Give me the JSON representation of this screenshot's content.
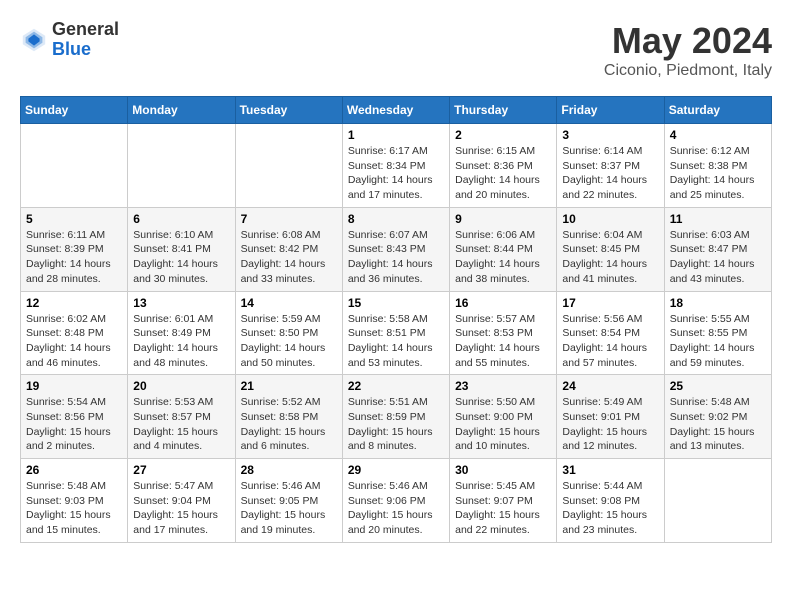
{
  "logo": {
    "general": "General",
    "blue": "Blue"
  },
  "title": {
    "month_year": "May 2024",
    "location": "Ciconio, Piedmont, Italy"
  },
  "weekdays": [
    "Sunday",
    "Monday",
    "Tuesday",
    "Wednesday",
    "Thursday",
    "Friday",
    "Saturday"
  ],
  "weeks": [
    [
      {
        "day": "",
        "info": ""
      },
      {
        "day": "",
        "info": ""
      },
      {
        "day": "",
        "info": ""
      },
      {
        "day": "1",
        "info": "Sunrise: 6:17 AM\nSunset: 8:34 PM\nDaylight: 14 hours\nand 17 minutes."
      },
      {
        "day": "2",
        "info": "Sunrise: 6:15 AM\nSunset: 8:36 PM\nDaylight: 14 hours\nand 20 minutes."
      },
      {
        "day": "3",
        "info": "Sunrise: 6:14 AM\nSunset: 8:37 PM\nDaylight: 14 hours\nand 22 minutes."
      },
      {
        "day": "4",
        "info": "Sunrise: 6:12 AM\nSunset: 8:38 PM\nDaylight: 14 hours\nand 25 minutes."
      }
    ],
    [
      {
        "day": "5",
        "info": "Sunrise: 6:11 AM\nSunset: 8:39 PM\nDaylight: 14 hours\nand 28 minutes."
      },
      {
        "day": "6",
        "info": "Sunrise: 6:10 AM\nSunset: 8:41 PM\nDaylight: 14 hours\nand 30 minutes."
      },
      {
        "day": "7",
        "info": "Sunrise: 6:08 AM\nSunset: 8:42 PM\nDaylight: 14 hours\nand 33 minutes."
      },
      {
        "day": "8",
        "info": "Sunrise: 6:07 AM\nSunset: 8:43 PM\nDaylight: 14 hours\nand 36 minutes."
      },
      {
        "day": "9",
        "info": "Sunrise: 6:06 AM\nSunset: 8:44 PM\nDaylight: 14 hours\nand 38 minutes."
      },
      {
        "day": "10",
        "info": "Sunrise: 6:04 AM\nSunset: 8:45 PM\nDaylight: 14 hours\nand 41 minutes."
      },
      {
        "day": "11",
        "info": "Sunrise: 6:03 AM\nSunset: 8:47 PM\nDaylight: 14 hours\nand 43 minutes."
      }
    ],
    [
      {
        "day": "12",
        "info": "Sunrise: 6:02 AM\nSunset: 8:48 PM\nDaylight: 14 hours\nand 46 minutes."
      },
      {
        "day": "13",
        "info": "Sunrise: 6:01 AM\nSunset: 8:49 PM\nDaylight: 14 hours\nand 48 minutes."
      },
      {
        "day": "14",
        "info": "Sunrise: 5:59 AM\nSunset: 8:50 PM\nDaylight: 14 hours\nand 50 minutes."
      },
      {
        "day": "15",
        "info": "Sunrise: 5:58 AM\nSunset: 8:51 PM\nDaylight: 14 hours\nand 53 minutes."
      },
      {
        "day": "16",
        "info": "Sunrise: 5:57 AM\nSunset: 8:53 PM\nDaylight: 14 hours\nand 55 minutes."
      },
      {
        "day": "17",
        "info": "Sunrise: 5:56 AM\nSunset: 8:54 PM\nDaylight: 14 hours\nand 57 minutes."
      },
      {
        "day": "18",
        "info": "Sunrise: 5:55 AM\nSunset: 8:55 PM\nDaylight: 14 hours\nand 59 minutes."
      }
    ],
    [
      {
        "day": "19",
        "info": "Sunrise: 5:54 AM\nSunset: 8:56 PM\nDaylight: 15 hours\nand 2 minutes."
      },
      {
        "day": "20",
        "info": "Sunrise: 5:53 AM\nSunset: 8:57 PM\nDaylight: 15 hours\nand 4 minutes."
      },
      {
        "day": "21",
        "info": "Sunrise: 5:52 AM\nSunset: 8:58 PM\nDaylight: 15 hours\nand 6 minutes."
      },
      {
        "day": "22",
        "info": "Sunrise: 5:51 AM\nSunset: 8:59 PM\nDaylight: 15 hours\nand 8 minutes."
      },
      {
        "day": "23",
        "info": "Sunrise: 5:50 AM\nSunset: 9:00 PM\nDaylight: 15 hours\nand 10 minutes."
      },
      {
        "day": "24",
        "info": "Sunrise: 5:49 AM\nSunset: 9:01 PM\nDaylight: 15 hours\nand 12 minutes."
      },
      {
        "day": "25",
        "info": "Sunrise: 5:48 AM\nSunset: 9:02 PM\nDaylight: 15 hours\nand 13 minutes."
      }
    ],
    [
      {
        "day": "26",
        "info": "Sunrise: 5:48 AM\nSunset: 9:03 PM\nDaylight: 15 hours\nand 15 minutes."
      },
      {
        "day": "27",
        "info": "Sunrise: 5:47 AM\nSunset: 9:04 PM\nDaylight: 15 hours\nand 17 minutes."
      },
      {
        "day": "28",
        "info": "Sunrise: 5:46 AM\nSunset: 9:05 PM\nDaylight: 15 hours\nand 19 minutes."
      },
      {
        "day": "29",
        "info": "Sunrise: 5:46 AM\nSunset: 9:06 PM\nDaylight: 15 hours\nand 20 minutes."
      },
      {
        "day": "30",
        "info": "Sunrise: 5:45 AM\nSunset: 9:07 PM\nDaylight: 15 hours\nand 22 minutes."
      },
      {
        "day": "31",
        "info": "Sunrise: 5:44 AM\nSunset: 9:08 PM\nDaylight: 15 hours\nand 23 minutes."
      },
      {
        "day": "",
        "info": ""
      }
    ]
  ]
}
